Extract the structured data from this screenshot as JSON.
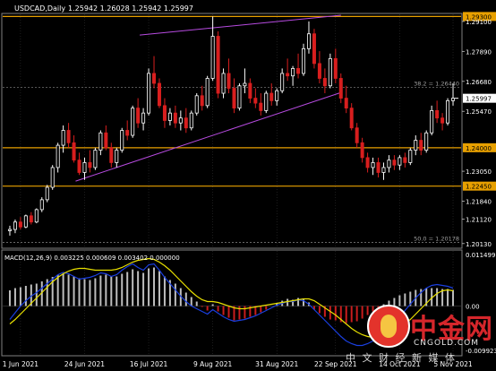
{
  "window": {
    "symbol_title": "USDCAD,Daily",
    "ohlc": "1.25942 1.26028 1.25942 1.25997"
  },
  "indicator": {
    "label": "MACD(12,26,9) 0.003225 0.000609 0.003402 0.000000"
  },
  "colors": {
    "background": "#000000",
    "grid": "#3a3a3a",
    "bull_candle": "#ffffff",
    "bear_candle": "#d81e1e",
    "hline": "#e8a000",
    "channel": "#b74be0",
    "current_price_label": "#ffffff",
    "macd_hist_pos": "#bdbdbd",
    "macd_hist_neg": "#c91d1d",
    "macd_line": "#1a3fe0",
    "signal_line": "#e8e000"
  },
  "watermark": {
    "brand": "中金网",
    "site": "CNGOLD.COM",
    "tagline": "中 文 财 经 新 媒 体",
    "logo_icon": "cngold-logo-icon"
  },
  "chart_data": {
    "type": "candlestick",
    "title": "USDCAD,Daily",
    "price_axis": {
      "ylim": [
        1.2005,
        1.2935
      ],
      "ticks": [
        "1.29300",
        "1.29100",
        "1.27890",
        "1.26680",
        "1.25997",
        "1.25470",
        "1.24000",
        "1.23050",
        "1.22450",
        "1.21840",
        "1.21120",
        "1.20130"
      ]
    },
    "x_tick_labels": [
      "1 Jun 2021",
      "24 Jun 2021",
      "16 Jul 2021",
      "9 Aug 2021",
      "31 Aug 2021",
      "22 Sep 2021",
      "14 Oct 2021",
      "5 Nov 2021"
    ],
    "horizontal_levels": [
      {
        "price": 1.293,
        "label": "1.29300",
        "highlighted": true
      },
      {
        "price": 1.24,
        "label": "1.24000",
        "highlighted": true
      },
      {
        "price": 1.2245,
        "label": "1.22450",
        "highlighted": true
      }
    ],
    "fibonacci": [
      {
        "price": 1.2644,
        "label": "38.2 = 1.26440"
      },
      {
        "price": 1.20178,
        "label": "50.0 = 1.20178"
      }
    ],
    "current_price": 1.25997,
    "channel": [
      {
        "from": [
          "16 Jul 2021",
          1.2855
        ],
        "to": [
          "22 Sep 2021",
          1.2935
        ]
      },
      {
        "from": [
          "24 Jun 2021",
          1.2265
        ],
        "to": [
          "22 Sep 2021",
          1.2623
        ]
      }
    ],
    "candles": [
      [
        1.2065,
        1.2085,
        1.2045,
        1.207
      ],
      [
        1.207,
        1.211,
        1.2055,
        1.21
      ],
      [
        1.21,
        1.212,
        1.207,
        1.208
      ],
      [
        1.208,
        1.213,
        1.2075,
        1.2125
      ],
      [
        1.2125,
        1.214,
        1.209,
        1.21
      ],
      [
        1.21,
        1.2155,
        1.2095,
        1.215
      ],
      [
        1.215,
        1.22,
        1.214,
        1.219
      ],
      [
        1.219,
        1.225,
        1.218,
        1.224
      ],
      [
        1.224,
        1.233,
        1.223,
        1.232
      ],
      [
        1.232,
        1.242,
        1.23,
        1.241
      ],
      [
        1.241,
        1.249,
        1.238,
        1.247
      ],
      [
        1.247,
        1.25,
        1.24,
        1.242
      ],
      [
        1.242,
        1.245,
        1.234,
        1.235
      ],
      [
        1.235,
        1.238,
        1.229,
        1.23
      ],
      [
        1.23,
        1.236,
        1.227,
        1.234
      ],
      [
        1.234,
        1.239,
        1.23,
        1.232
      ],
      [
        1.232,
        1.24,
        1.231,
        1.239
      ],
      [
        1.239,
        1.247,
        1.237,
        1.246
      ],
      [
        1.246,
        1.249,
        1.239,
        1.24
      ],
      [
        1.24,
        1.242,
        1.232,
        1.234
      ],
      [
        1.234,
        1.24,
        1.232,
        1.239
      ],
      [
        1.239,
        1.248,
        1.238,
        1.247
      ],
      [
        1.247,
        1.251,
        1.243,
        1.245
      ],
      [
        1.245,
        1.257,
        1.244,
        1.256
      ],
      [
        1.256,
        1.26,
        1.248,
        1.25
      ],
      [
        1.25,
        1.256,
        1.247,
        1.254
      ],
      [
        1.254,
        1.272,
        1.253,
        1.27
      ],
      [
        1.27,
        1.277,
        1.264,
        1.266
      ],
      [
        1.266,
        1.268,
        1.256,
        1.257
      ],
      [
        1.257,
        1.26,
        1.248,
        1.251
      ],
      [
        1.251,
        1.256,
        1.249,
        1.254
      ],
      [
        1.254,
        1.257,
        1.248,
        1.25
      ],
      [
        1.25,
        1.255,
        1.247,
        1.252
      ],
      [
        1.252,
        1.256,
        1.246,
        1.248
      ],
      [
        1.248,
        1.255,
        1.247,
        1.254
      ],
      [
        1.254,
        1.262,
        1.253,
        1.261
      ],
      [
        1.261,
        1.265,
        1.255,
        1.257
      ],
      [
        1.257,
        1.269,
        1.256,
        1.268
      ],
      [
        1.268,
        1.293,
        1.267,
        1.285
      ],
      [
        1.285,
        1.287,
        1.26,
        1.262
      ],
      [
        1.262,
        1.272,
        1.26,
        1.27
      ],
      [
        1.27,
        1.276,
        1.262,
        1.264
      ],
      [
        1.264,
        1.268,
        1.254,
        1.256
      ],
      [
        1.256,
        1.266,
        1.255,
        1.265
      ],
      [
        1.265,
        1.272,
        1.262,
        1.266
      ],
      [
        1.266,
        1.268,
        1.258,
        1.26
      ],
      [
        1.26,
        1.264,
        1.256,
        1.258
      ],
      [
        1.258,
        1.262,
        1.253,
        1.255
      ],
      [
        1.255,
        1.263,
        1.254,
        1.262
      ],
      [
        1.262,
        1.266,
        1.257,
        1.259
      ],
      [
        1.259,
        1.264,
        1.257,
        1.263
      ],
      [
        1.263,
        1.272,
        1.262,
        1.27
      ],
      [
        1.27,
        1.276,
        1.267,
        1.269
      ],
      [
        1.269,
        1.273,
        1.265,
        1.272
      ],
      [
        1.272,
        1.278,
        1.268,
        1.27
      ],
      [
        1.27,
        1.282,
        1.269,
        1.28
      ],
      [
        1.28,
        1.291,
        1.278,
        1.286
      ],
      [
        1.286,
        1.288,
        1.272,
        1.274
      ],
      [
        1.274,
        1.279,
        1.266,
        1.268
      ],
      [
        1.268,
        1.272,
        1.262,
        1.265
      ],
      [
        1.265,
        1.278,
        1.264,
        1.276
      ],
      [
        1.276,
        1.28,
        1.266,
        1.268
      ],
      [
        1.268,
        1.27,
        1.258,
        1.26
      ],
      [
        1.26,
        1.265,
        1.254,
        1.256
      ],
      [
        1.256,
        1.258,
        1.247,
        1.248
      ],
      [
        1.248,
        1.25,
        1.24,
        1.242
      ],
      [
        1.242,
        1.244,
        1.234,
        1.236
      ],
      [
        1.236,
        1.238,
        1.23,
        1.232
      ],
      [
        1.232,
        1.236,
        1.229,
        1.234
      ],
      [
        1.234,
        1.236,
        1.228,
        1.23
      ],
      [
        1.23,
        1.234,
        1.227,
        1.232
      ],
      [
        1.232,
        1.237,
        1.23,
        1.235
      ],
      [
        1.235,
        1.237,
        1.231,
        1.233
      ],
      [
        1.233,
        1.237,
        1.231,
        1.236
      ],
      [
        1.236,
        1.238,
        1.232,
        1.234
      ],
      [
        1.234,
        1.24,
        1.233,
        1.239
      ],
      [
        1.239,
        1.245,
        1.237,
        1.243
      ],
      [
        1.243,
        1.246,
        1.237,
        1.239
      ],
      [
        1.239,
        1.247,
        1.238,
        1.246
      ],
      [
        1.246,
        1.257,
        1.245,
        1.255
      ],
      [
        1.255,
        1.259,
        1.25,
        1.252
      ],
      [
        1.252,
        1.254,
        1.247,
        1.25
      ],
      [
        1.25,
        1.26,
        1.249,
        1.259
      ],
      [
        1.259,
        1.266,
        1.257,
        1.26
      ]
    ],
    "macd": {
      "label": "MACD(12,26,9) 0.003225 0.000609 0.003402 0.000000",
      "ylim": [
        -0.0107,
        0.0121
      ],
      "ticks": [
        "0.011499",
        "0.00",
        "-0.009923"
      ],
      "histogram": [
        0.0035,
        0.004,
        0.0042,
        0.0045,
        0.0048,
        0.005,
        0.0055,
        0.006,
        0.0065,
        0.007,
        0.0072,
        0.007,
        0.0066,
        0.0062,
        0.006,
        0.0058,
        0.0062,
        0.0068,
        0.007,
        0.0066,
        0.0066,
        0.0072,
        0.0076,
        0.0082,
        0.0078,
        0.0074,
        0.0084,
        0.0086,
        0.0078,
        0.0066,
        0.0058,
        0.005,
        0.004,
        0.003,
        0.002,
        0.001,
        -0.0002,
        -0.001,
        0.0004,
        -0.0012,
        -0.002,
        -0.0026,
        -0.0032,
        -0.003,
        -0.0028,
        -0.0024,
        -0.002,
        -0.0014,
        -0.0008,
        0.0,
        0.0006,
        0.0012,
        0.0016,
        0.0014,
        0.0018,
        0.0016,
        0.0008,
        -0.0008,
        -0.0016,
        -0.0024,
        -0.003,
        -0.0032,
        -0.0036,
        -0.0038,
        -0.0036,
        -0.0034,
        -0.0028,
        -0.002,
        -0.0012,
        -0.0004,
        0.0004,
        0.0012,
        0.0018,
        0.0024,
        0.0028,
        0.0032,
        0.0036,
        0.0038,
        0.004,
        0.004,
        0.004,
        0.0038,
        0.0038,
        0.0036
      ],
      "signal": [
        -0.004,
        -0.003,
        -0.0018,
        -0.0006,
        0.0006,
        0.0018,
        0.003,
        0.0042,
        0.0054,
        0.0064,
        0.0072,
        0.0078,
        0.0082,
        0.0084,
        0.0084,
        0.0082,
        0.008,
        0.008,
        0.008,
        0.008,
        0.0082,
        0.0086,
        0.0092,
        0.0098,
        0.0102,
        0.0104,
        0.0106,
        0.0104,
        0.0098,
        0.009,
        0.008,
        0.0068,
        0.0056,
        0.0044,
        0.0032,
        0.0022,
        0.0014,
        0.001,
        0.001,
        0.0008,
        0.0004,
        0.0,
        -0.0004,
        -0.0006,
        -0.0006,
        -0.0004,
        -0.0002,
        0.0,
        0.0002,
        0.0004,
        0.0006,
        0.0008,
        0.001,
        0.0012,
        0.0014,
        0.0016,
        0.0016,
        0.0012,
        0.0004,
        -0.0004,
        -0.0012,
        -0.002,
        -0.003,
        -0.004,
        -0.005,
        -0.0058,
        -0.0064,
        -0.0068,
        -0.007,
        -0.007,
        -0.0068,
        -0.0064,
        -0.0058,
        -0.005,
        -0.004,
        -0.003,
        -0.0018,
        -0.0006,
        0.0006,
        0.0018,
        0.0028,
        0.0034,
        0.0036,
        0.0034
      ],
      "macd_line": [
        -0.003,
        -0.0015,
        0.0,
        0.0012,
        0.0022,
        0.003,
        0.004,
        0.005,
        0.006,
        0.007,
        0.0075,
        0.0072,
        0.0066,
        0.006,
        0.0062,
        0.0064,
        0.0068,
        0.0074,
        0.0072,
        0.0066,
        0.007,
        0.008,
        0.0088,
        0.0094,
        0.0086,
        0.008,
        0.0092,
        0.0094,
        0.008,
        0.0064,
        0.005,
        0.0036,
        0.0022,
        0.001,
        0.0,
        -0.0006,
        -0.0012,
        -0.0018,
        -0.0008,
        -0.0016,
        -0.0024,
        -0.003,
        -0.0034,
        -0.0032,
        -0.003,
        -0.0026,
        -0.0022,
        -0.0016,
        -0.001,
        -0.0004,
        0.0002,
        0.0006,
        0.001,
        0.001,
        0.0014,
        0.0012,
        0.0004,
        -0.0008,
        -0.002,
        -0.0032,
        -0.0044,
        -0.0056,
        -0.0068,
        -0.0078,
        -0.0084,
        -0.0088,
        -0.0088,
        -0.0084,
        -0.0078,
        -0.007,
        -0.006,
        -0.0048,
        -0.0036,
        -0.0024,
        -0.001,
        0.0004,
        0.0018,
        0.003,
        0.004,
        0.0046,
        0.0048,
        0.0046,
        0.0044,
        0.004
      ]
    }
  }
}
